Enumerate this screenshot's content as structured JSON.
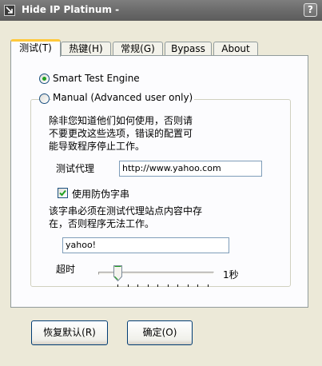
{
  "window": {
    "title": "Hide IP Platinum -",
    "help_label": "?"
  },
  "tabs": [
    {
      "label": "测试(T)",
      "active": true
    },
    {
      "label": "热键(H)",
      "active": false
    },
    {
      "label": "常规(G)",
      "active": false
    },
    {
      "label": "Bypass",
      "active": false
    },
    {
      "label": "About",
      "active": false
    }
  ],
  "test_tab": {
    "smart_engine_label": "Smart Test Engine",
    "smart_engine_selected": true,
    "manual_label": "Manual (Advanced user only)",
    "manual_selected": false,
    "warning_line1": "除非您知道他们如何使用，否则请",
    "warning_line2": "不要更改这些选项，错误的配置可",
    "warning_line3": "能导致程序停止工作。",
    "proxy_label": "测试代理",
    "proxy_value": "http://www.yahoo.com",
    "anti_fake_label": "使用防伪字串",
    "anti_fake_checked": true,
    "string_note_line1": "该字串必须在测试代理站点内容中存",
    "string_note_line2": "在，否则程序无法工作。",
    "string_value": "yahoo!",
    "timeout_label": "超时",
    "timeout_value_label": "1秒",
    "timeout_level_fraction": 0.0
  },
  "buttons": {
    "restore_defaults": "恢复默认(R)",
    "ok": "确定(O)"
  },
  "colors": {
    "titlebar": "#6b6b6b",
    "dialog_bg": "#ece9d8",
    "panel_bg": "#fcfcfe",
    "active_tab_accent": "#ffc83c",
    "radio_dot": "#21a121",
    "check_mark": "#21a121",
    "button_border": "#003c74"
  }
}
